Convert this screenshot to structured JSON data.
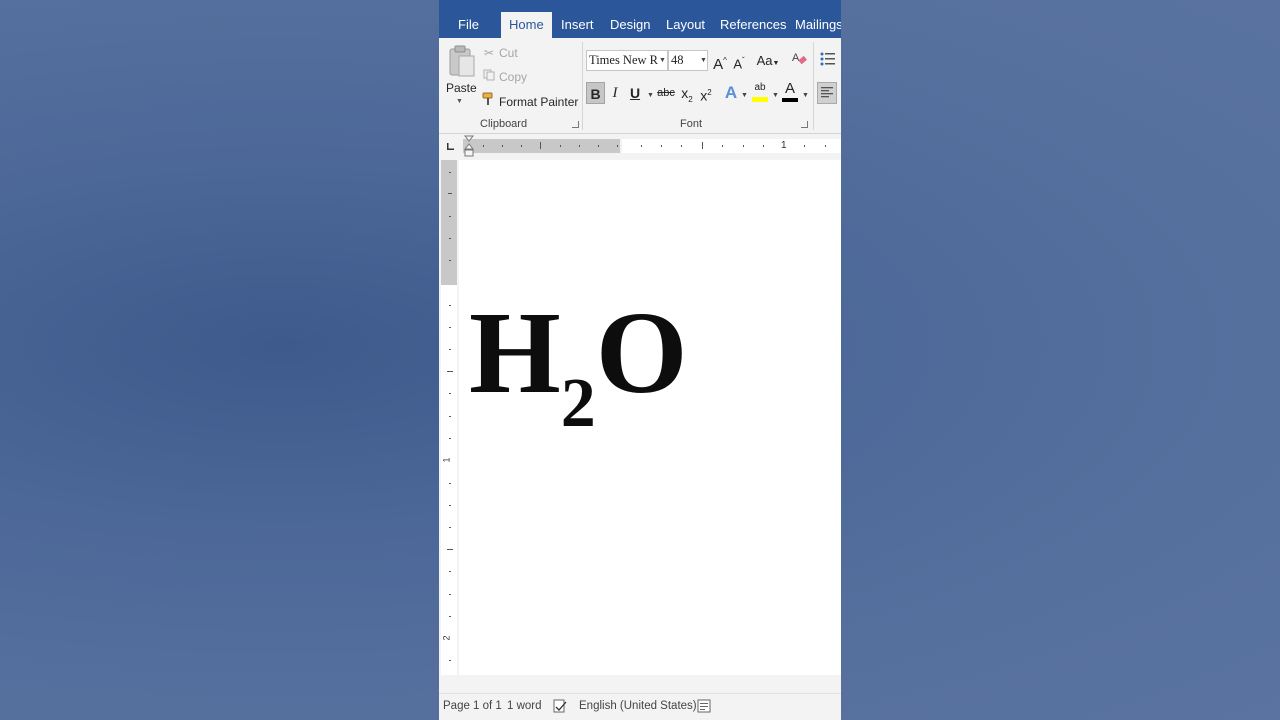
{
  "tabs": {
    "file": "File",
    "home": "Home",
    "insert": "Insert",
    "design": "Design",
    "layout": "Layout",
    "references": "References",
    "mailings": "Mailings"
  },
  "clipboard": {
    "paste": "Paste",
    "cut": "Cut",
    "copy": "Copy",
    "format_painter": "Format Painter",
    "group_label": "Clipboard"
  },
  "font": {
    "family": "Times New R",
    "size": "48",
    "grow": "A",
    "shrink": "A",
    "case": "Aa",
    "bold": "B",
    "italic": "I",
    "underline": "U",
    "strikethrough": "abc",
    "subscript_base": "x",
    "subscript_mark": "2",
    "superscript_base": "x",
    "superscript_mark": "2",
    "text_effects": "A",
    "highlight": "ab",
    "font_color": "A",
    "group_label": "Font"
  },
  "ruler": {
    "h_number": "1",
    "v_numbers": [
      "1",
      "2"
    ]
  },
  "document": {
    "h": "H",
    "sub": "2",
    "o": "O"
  },
  "status": {
    "page": "Page 1 of 1",
    "words": "1 word",
    "language": "English (United States)"
  },
  "colors": {
    "ribbon_blue": "#2b579a",
    "highlight_yellow": "#ffff00",
    "font_color_bar": "#000000"
  }
}
